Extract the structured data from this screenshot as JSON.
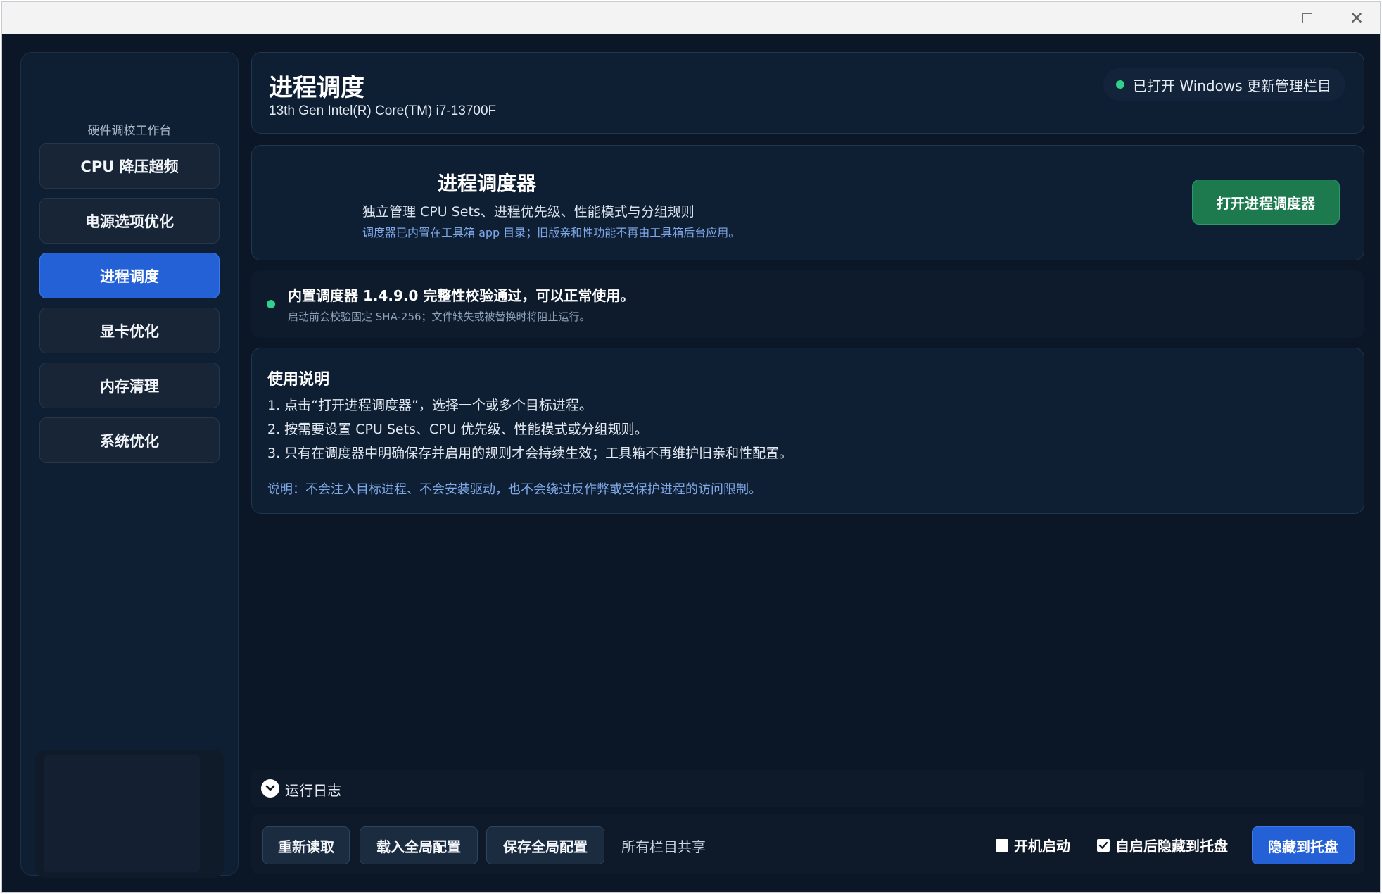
{
  "window": {
    "controls": {
      "minimize_icon": "minimize-icon",
      "maximize_icon": "maximize-icon",
      "close_icon": "close-icon"
    }
  },
  "sidebar": {
    "title": "硬件调校工作台",
    "items": [
      {
        "label": "CPU 降压超频",
        "active": false
      },
      {
        "label": "电源选项优化",
        "active": false
      },
      {
        "label": "进程调度",
        "active": true
      },
      {
        "label": "显卡优化",
        "active": false
      },
      {
        "label": "内存清理",
        "active": false
      },
      {
        "label": "系统优化",
        "active": false
      }
    ]
  },
  "header": {
    "title": "进程调度",
    "subtitle": "13th Gen Intel(R) Core(TM) i7-13700F",
    "status": "已打开 Windows 更新管理栏目"
  },
  "scheduler": {
    "title": "进程调度器",
    "description": "独立管理 CPU Sets、进程优先级、性能模式与分组规则",
    "note": "调度器已内置在工具箱 app 目录；旧版亲和性功能不再由工具箱后台应用。",
    "open_button": "打开进程调度器"
  },
  "verify": {
    "title": "内置调度器 1.4.9.0 完整性校验通过，可以正常使用。",
    "subtitle": "启动前会校验固定 SHA-256；文件缺失或被替换时将阻止运行。"
  },
  "usage": {
    "title": "使用说明",
    "steps": [
      "1. 点击“打开进程调度器”，选择一个或多个目标进程。",
      "2. 按需要设置 CPU Sets、CPU 优先级、性能模式或分组规则。",
      "3. 只有在调度器中明确保存并启用的规则才会持续生效；工具箱不再维护旧亲和性配置。"
    ],
    "note": "说明：不会注入目标进程、不会安装驱动，也不会绕过反作弊或受保护进程的访问限制。"
  },
  "log": {
    "label": "运行日志"
  },
  "bottom": {
    "reload": "重新读取",
    "load_global": "载入全局配置",
    "save_global": "保存全局配置",
    "shared_text": "所有栏目共享",
    "autostart_label": "开机启动",
    "autostart_checked": false,
    "hide_label": "自启后隐藏到托盘",
    "hide_checked": true,
    "tray_button": "隐藏到托盘"
  },
  "colors": {
    "background": "#0b1626",
    "accent_blue": "#2461d6",
    "accent_green": "#1c7a4e",
    "status_green": "#2fd18b",
    "note_blue": "#7fa8e8"
  }
}
